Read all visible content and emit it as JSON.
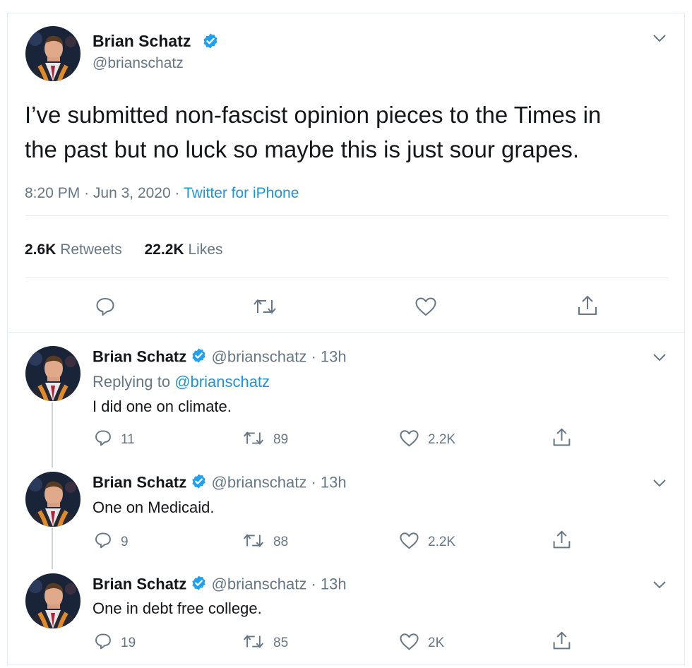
{
  "main_tweet": {
    "author_name": "Brian Schatz",
    "handle": "@brianschatz",
    "text_line1": "I’ve submitted non-fascist opinion pieces to the Times in",
    "text_line2": "the past but no luck so maybe this is just sour grapes.",
    "time": "8:20 PM",
    "date": "Jun 3, 2020",
    "dot": "·",
    "source": "Twitter for iPhone",
    "retweets_count": "2.6K",
    "retweets_label": "Retweets",
    "likes_count": "22.2K",
    "likes_label": "Likes"
  },
  "replies": [
    {
      "author_name": "Brian Schatz",
      "handle": "@brianschatz",
      "age": "· 13h",
      "replying_label": "Replying to",
      "replying_handle": "@brianschatz",
      "text": "I did one on climate.",
      "reply_count": "11",
      "retweet_count": "89",
      "like_count": "2.2K"
    },
    {
      "author_name": "Brian Schatz",
      "handle": "@brianschatz",
      "age": "· 13h",
      "text": "One on Medicaid.",
      "reply_count": "9",
      "retweet_count": "88",
      "like_count": "2.2K"
    },
    {
      "author_name": "Brian Schatz",
      "handle": "@brianschatz",
      "age": "· 13h",
      "text": "One in debt free college.",
      "reply_count": "19",
      "retweet_count": "85",
      "like_count": "2K"
    }
  ],
  "icons": {
    "verified": "verified-badge-icon",
    "chevron": "chevron-down-icon",
    "reply": "reply-icon",
    "retweet": "retweet-icon",
    "like": "heart-icon",
    "share": "share-icon"
  },
  "colors": {
    "verified_blue": "#1da1f2",
    "link_blue": "#1b95e0",
    "gray_text": "#657786",
    "border": "#e6ecf0"
  }
}
